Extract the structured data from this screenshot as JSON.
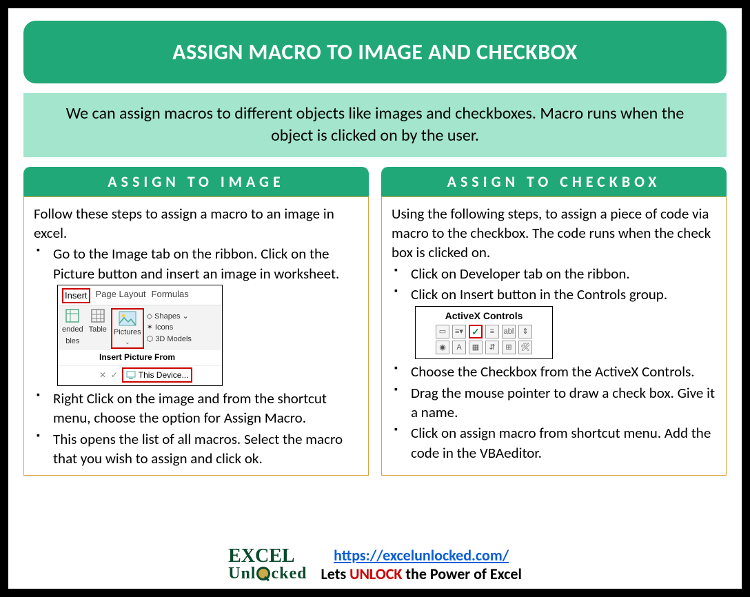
{
  "title": "ASSIGN MACRO TO IMAGE AND CHECKBOX",
  "intro": "We can assign macros to different objects like images and checkboxes. Macro runs when the object is clicked on by the user.",
  "left": {
    "header": "ASSIGN TO IMAGE",
    "lead": "Follow these steps to assign a macro to an image in excel.",
    "step1": "Go to the Image tab on the ribbon. Click on the Picture button and insert an image in worksheet.",
    "step2": "Right Click on the image and from the shortcut menu, choose the option for Assign Macro.",
    "step3": "This opens the list of all macros. Select the macro that you wish to assign and click ok.",
    "ss": {
      "tab_insert": "Insert",
      "tab_pagelayout": "Page Layout",
      "tab_formulas": "Formulas",
      "ended": "ended",
      "bles": "bles",
      "table": "Table",
      "pictures": "Pictures",
      "shapes": "Shapes",
      "icons": "Icons",
      "models": "3D Models",
      "insfrom": "Insert Picture From",
      "device": "This Device..."
    }
  },
  "right": {
    "header": "ASSIGN TO CHECKBOX",
    "lead": "Using the following steps, to assign a piece of code via macro to the checkbox. The code runs when the check box is clicked on.",
    "step1": "Click on Developer tab on the ribbon.",
    "step2": "Click on Insert button in the Controls group.",
    "step3": "Choose the Checkbox from the ActiveX Controls.",
    "step4": "Drag the mouse pointer to draw a check box. Give it a name.",
    "step5": "Click on assign macro from shortcut menu. Add the code in the VBAeditor.",
    "ss": {
      "title": "ActiveX Controls",
      "abl": "abl"
    }
  },
  "footer": {
    "logo1": "EXCEL",
    "logo2_pre": "Unl",
    "logo2_post": "cked",
    "url": "https://excelunlocked.com/",
    "tag_pre": "Lets ",
    "tag_unlock": "UNLOCK",
    "tag_post": " the Power of Excel"
  }
}
